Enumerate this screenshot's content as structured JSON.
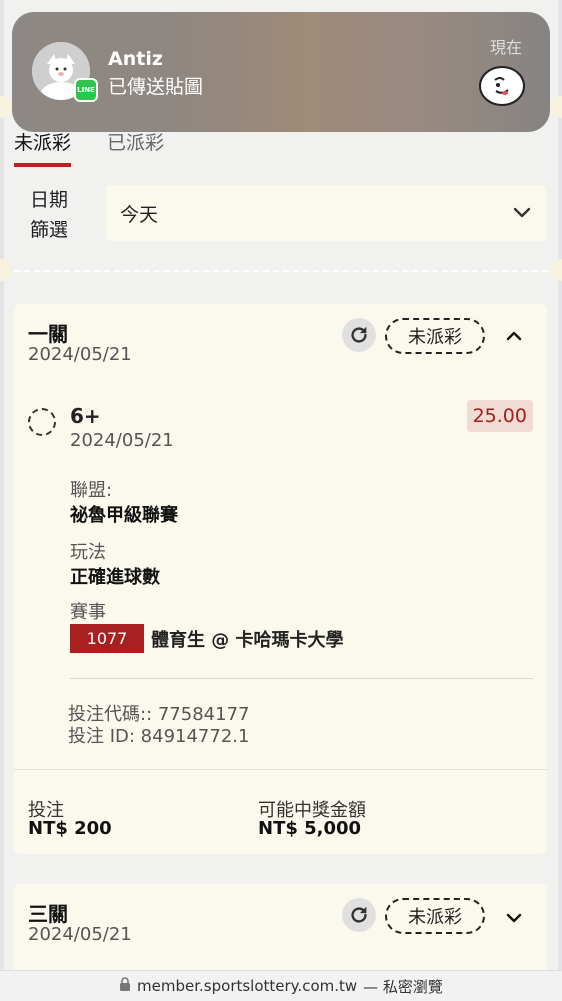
{
  "notification": {
    "sender": "Antiz",
    "message": "已傳送貼圖",
    "time": "現在",
    "app_badge": "LINE"
  },
  "tabs": [
    {
      "label": "未派彩",
      "active": true
    },
    {
      "label": "已派彩",
      "active": false
    }
  ],
  "filter": {
    "label_line1": "日期",
    "label_line2": "篩選",
    "value": "今天"
  },
  "bets": [
    {
      "title": "一關",
      "date": "2024/05/21",
      "status": "未派彩",
      "expanded": true,
      "selection": "6+",
      "selection_date": "2024/05/21",
      "odds": "25.00",
      "league_label": "聯盟:",
      "league": "祕魯甲級聯賽",
      "market_label": "玩法",
      "market": "正確進球數",
      "event_label": "賽事",
      "event_no": "1077",
      "event": "體育生 @ 卡哈瑪卡大學",
      "bet_code": "投注代碼:: 77584177",
      "bet_id": "投注 ID: 84914772.1",
      "stake_label": "投注",
      "stake": "NT$ 200",
      "payout_label": "可能中獎金額",
      "payout": "NT$ 5,000"
    },
    {
      "title": "三關",
      "date": "2024/05/21",
      "status": "未派彩",
      "expanded": false
    }
  ],
  "browser": {
    "url": "member.sportslottery.com.tw",
    "mode": "— 私密瀏覽"
  },
  "colors": {
    "accent_red": "#b82222",
    "card_bg": "#fbf9ee",
    "page_bg": "#f1f1f0"
  }
}
